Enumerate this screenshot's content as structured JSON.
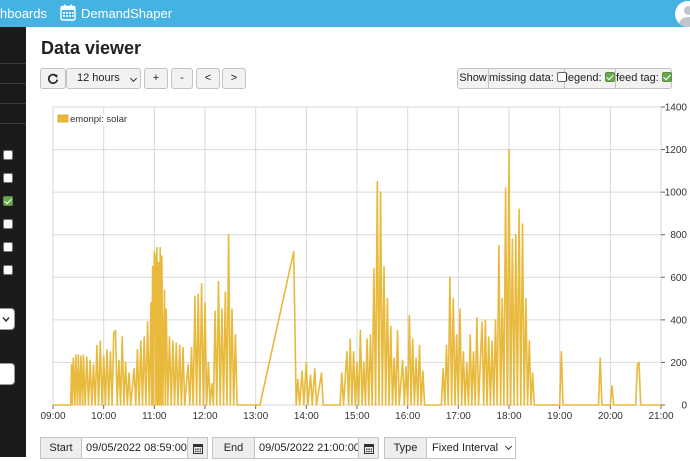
{
  "topbar": {
    "dashboards_label": "hboards",
    "demandshaper_label": "DemandShaper"
  },
  "page": {
    "title": "Data viewer"
  },
  "toolbar": {
    "refresh_icon": "refresh-icon",
    "interval_value": "12 hours",
    "zoom_in_label": "+",
    "zoom_out_label": "-",
    "pan_left_label": "<",
    "pan_right_label": ">"
  },
  "options": {
    "show_label": "Show",
    "missing_data_label": "missing data:",
    "missing_data_checked": false,
    "legend_label": "legend:",
    "legend_checked": true,
    "feed_tag_label": "feed tag:",
    "feed_tag_checked": true
  },
  "sidebar": {
    "checkboxes": [
      false,
      false,
      true,
      false,
      false,
      false
    ]
  },
  "time_range": {
    "start_label": "Start",
    "start_value": "09/05/2022 08:59:00",
    "end_label": "End",
    "end_value": "09/05/2022 21:00:00",
    "type_label": "Type",
    "type_value": "Fixed Interval"
  },
  "chart_data": {
    "type": "line",
    "legend": [
      "emonpi: solar"
    ],
    "series": [
      {
        "name": "emonpi: solar",
        "color": "#e8b93a",
        "points": [
          [
            "09:00",
            0
          ],
          [
            "09:21",
            0
          ],
          [
            "09:22",
            190
          ],
          [
            "09:23",
            0
          ],
          [
            "09:24",
            220
          ],
          [
            "09:26",
            0
          ],
          [
            "09:27",
            235
          ],
          [
            "09:29",
            0
          ],
          [
            "09:30",
            235
          ],
          [
            "09:32",
            0
          ],
          [
            "09:33",
            230
          ],
          [
            "09:35",
            0
          ],
          [
            "09:36",
            235
          ],
          [
            "09:38",
            0
          ],
          [
            "09:40",
            225
          ],
          [
            "09:42",
            0
          ],
          [
            "09:44",
            210
          ],
          [
            "09:46",
            0
          ],
          [
            "09:48",
            190
          ],
          [
            "09:50",
            0
          ],
          [
            "09:52",
            280
          ],
          [
            "09:54",
            0
          ],
          [
            "09:56",
            300
          ],
          [
            "09:58",
            0
          ],
          [
            "10:00",
            230
          ],
          [
            "10:02",
            0
          ],
          [
            "10:04",
            260
          ],
          [
            "10:06",
            0
          ],
          [
            "10:08",
            250
          ],
          [
            "10:10",
            0
          ],
          [
            "10:12",
            340
          ],
          [
            "10:14",
            350
          ],
          [
            "10:16",
            0
          ],
          [
            "10:18",
            210
          ],
          [
            "10:20",
            0
          ],
          [
            "10:22",
            320
          ],
          [
            "10:24",
            0
          ],
          [
            "10:26",
            200
          ],
          [
            "10:28",
            0
          ],
          [
            "10:30",
            150
          ],
          [
            "10:32",
            0
          ],
          [
            "10:36",
            170
          ],
          [
            "10:38",
            0
          ],
          [
            "10:40",
            260
          ],
          [
            "10:42",
            0
          ],
          [
            "10:44",
            300
          ],
          [
            "10:46",
            0
          ],
          [
            "10:48",
            320
          ],
          [
            "10:50",
            0
          ],
          [
            "10:52",
            390
          ],
          [
            "10:54",
            0
          ],
          [
            "10:56",
            480
          ],
          [
            "10:57",
            0
          ],
          [
            "10:58",
            650
          ],
          [
            "10:59",
            0
          ],
          [
            "11:00",
            720
          ],
          [
            "11:01",
            700
          ],
          [
            "11:02",
            0
          ],
          [
            "11:03",
            740
          ],
          [
            "11:04",
            0
          ],
          [
            "11:05",
            670
          ],
          [
            "11:06",
            0
          ],
          [
            "11:07",
            740
          ],
          [
            "11:08",
            0
          ],
          [
            "11:09",
            700
          ],
          [
            "11:10",
            0
          ],
          [
            "11:12",
            540
          ],
          [
            "11:13",
            0
          ],
          [
            "11:14",
            450
          ],
          [
            "11:16",
            0
          ],
          [
            "11:18",
            320
          ],
          [
            "11:20",
            0
          ],
          [
            "11:22",
            300
          ],
          [
            "11:24",
            0
          ],
          [
            "11:26",
            290
          ],
          [
            "11:28",
            0
          ],
          [
            "11:30",
            280
          ],
          [
            "11:32",
            0
          ],
          [
            "11:34",
            270
          ],
          [
            "11:36",
            0
          ],
          [
            "11:40",
            190
          ],
          [
            "11:42",
            0
          ],
          [
            "11:44",
            270
          ],
          [
            "11:46",
            0
          ],
          [
            "11:48",
            510
          ],
          [
            "11:50",
            0
          ],
          [
            "11:52",
            520
          ],
          [
            "11:54",
            0
          ],
          [
            "11:56",
            570
          ],
          [
            "11:58",
            0
          ],
          [
            "12:00",
            480
          ],
          [
            "12:02",
            0
          ],
          [
            "12:04",
            200
          ],
          [
            "12:06",
            0
          ],
          [
            "12:08",
            100
          ],
          [
            "12:10",
            0
          ],
          [
            "12:12",
            440
          ],
          [
            "12:14",
            0
          ],
          [
            "12:16",
            580
          ],
          [
            "12:18",
            0
          ],
          [
            "12:20",
            450
          ],
          [
            "12:22",
            0
          ],
          [
            "12:24",
            530
          ],
          [
            "12:26",
            0
          ],
          [
            "12:28",
            800
          ],
          [
            "12:30",
            0
          ],
          [
            "12:32",
            450
          ],
          [
            "12:34",
            0
          ],
          [
            "12:36",
            330
          ],
          [
            "12:38",
            0
          ],
          [
            "13:00",
            0
          ],
          [
            "13:05",
            0
          ],
          [
            "13:45",
            720
          ],
          [
            "13:48",
            0
          ],
          [
            "13:50",
            120
          ],
          [
            "13:52",
            0
          ],
          [
            "13:55",
            160
          ],
          [
            "13:57",
            0
          ],
          [
            "14:00",
            200
          ],
          [
            "14:02",
            0
          ],
          [
            "14:05",
            140
          ],
          [
            "14:07",
            0
          ],
          [
            "14:10",
            170
          ],
          [
            "14:12",
            0
          ],
          [
            "14:18",
            150
          ],
          [
            "14:20",
            0
          ],
          [
            "14:40",
            0
          ],
          [
            "14:42",
            150
          ],
          [
            "14:44",
            0
          ],
          [
            "14:48",
            250
          ],
          [
            "14:50",
            0
          ],
          [
            "14:52",
            310
          ],
          [
            "14:54",
            0
          ],
          [
            "14:56",
            250
          ],
          [
            "14:58",
            0
          ],
          [
            "15:00",
            200
          ],
          [
            "15:02",
            0
          ],
          [
            "15:04",
            350
          ],
          [
            "15:06",
            0
          ],
          [
            "15:08",
            200
          ],
          [
            "15:10",
            0
          ],
          [
            "15:12",
            310
          ],
          [
            "15:14",
            0
          ],
          [
            "15:16",
            330
          ],
          [
            "15:18",
            0
          ],
          [
            "15:20",
            640
          ],
          [
            "15:22",
            0
          ],
          [
            "15:24",
            1050
          ],
          [
            "15:26",
            0
          ],
          [
            "15:28",
            1000
          ],
          [
            "15:30",
            0
          ],
          [
            "15:32",
            650
          ],
          [
            "15:34",
            0
          ],
          [
            "15:36",
            500
          ],
          [
            "15:38",
            0
          ],
          [
            "15:40",
            370
          ],
          [
            "15:42",
            0
          ],
          [
            "15:44",
            220
          ],
          [
            "15:46",
            0
          ],
          [
            "15:48",
            350
          ],
          [
            "15:50",
            0
          ],
          [
            "15:54",
            210
          ],
          [
            "15:56",
            0
          ],
          [
            "15:58",
            180
          ],
          [
            "16:00",
            0
          ],
          [
            "16:02",
            420
          ],
          [
            "16:04",
            0
          ],
          [
            "16:06",
            310
          ],
          [
            "16:08",
            0
          ],
          [
            "16:10",
            220
          ],
          [
            "16:12",
            0
          ],
          [
            "16:14",
            280
          ],
          [
            "16:16",
            0
          ],
          [
            "16:18",
            160
          ],
          [
            "16:20",
            0
          ],
          [
            "16:40",
            0
          ],
          [
            "16:42",
            170
          ],
          [
            "16:44",
            0
          ],
          [
            "16:46",
            280
          ],
          [
            "16:48",
            0
          ],
          [
            "16:50",
            600
          ],
          [
            "16:52",
            0
          ],
          [
            "16:54",
            500
          ],
          [
            "16:56",
            0
          ],
          [
            "16:58",
            330
          ],
          [
            "17:00",
            0
          ],
          [
            "17:02",
            450
          ],
          [
            "17:04",
            0
          ],
          [
            "17:06",
            250
          ],
          [
            "17:08",
            0
          ],
          [
            "17:10",
            200
          ],
          [
            "17:12",
            0
          ],
          [
            "17:14",
            330
          ],
          [
            "17:16",
            0
          ],
          [
            "17:18",
            250
          ],
          [
            "17:20",
            0
          ],
          [
            "17:22",
            410
          ],
          [
            "17:24",
            0
          ],
          [
            "17:28",
            390
          ],
          [
            "17:30",
            0
          ],
          [
            "17:32",
            400
          ],
          [
            "17:34",
            0
          ],
          [
            "17:36",
            320
          ],
          [
            "17:38",
            0
          ],
          [
            "17:40",
            300
          ],
          [
            "17:42",
            0
          ],
          [
            "17:44",
            400
          ],
          [
            "17:46",
            0
          ],
          [
            "17:48",
            750
          ],
          [
            "17:50",
            0
          ],
          [
            "17:52",
            500
          ],
          [
            "17:54",
            0
          ],
          [
            "17:56",
            1020
          ],
          [
            "17:58",
            0
          ],
          [
            "18:00",
            1200
          ],
          [
            "18:02",
            0
          ],
          [
            "18:04",
            780
          ],
          [
            "18:06",
            0
          ],
          [
            "18:08",
            800
          ],
          [
            "18:10",
            0
          ],
          [
            "18:12",
            920
          ],
          [
            "18:14",
            0
          ],
          [
            "18:16",
            850
          ],
          [
            "18:18",
            0
          ],
          [
            "18:20",
            500
          ],
          [
            "18:22",
            0
          ],
          [
            "18:24",
            300
          ],
          [
            "18:26",
            0
          ],
          [
            "18:28",
            150
          ],
          [
            "18:30",
            0
          ],
          [
            "19:00",
            0
          ],
          [
            "19:02",
            250
          ],
          [
            "19:04",
            0
          ],
          [
            "19:46",
            0
          ],
          [
            "19:48",
            220
          ],
          [
            "19:50",
            0
          ],
          [
            "20:00",
            0
          ],
          [
            "20:02",
            90
          ],
          [
            "20:04",
            0
          ],
          [
            "20:30",
            0
          ],
          [
            "20:32",
            190
          ],
          [
            "20:34",
            200
          ],
          [
            "20:36",
            0
          ],
          [
            "21:00",
            0
          ]
        ]
      }
    ],
    "x_ticks": [
      "09:00",
      "10:00",
      "11:00",
      "12:00",
      "13:00",
      "14:00",
      "15:00",
      "16:00",
      "17:00",
      "18:00",
      "19:00",
      "20:00",
      "21:00"
    ],
    "y_ticks": [
      0,
      200,
      400,
      600,
      800,
      1000,
      1200,
      1400
    ],
    "xlim": [
      "09:00",
      "21:00"
    ],
    "ylim": [
      0,
      1400
    ],
    "y_axis_side": "right",
    "grid": true,
    "legend_placement": "top-left"
  }
}
